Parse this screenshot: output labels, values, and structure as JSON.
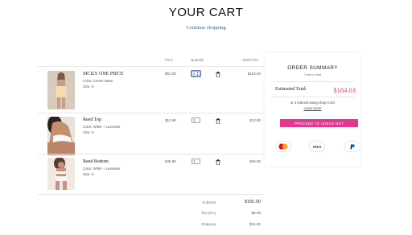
{
  "page": {
    "title": "YOUR CART",
    "continue_label": "Continue shopping"
  },
  "table_headers": {
    "price": "Price",
    "quantity": "Quantity",
    "total_price": "Total Price"
  },
  "items": [
    {
      "name": "SICILY ONE PIECE",
      "color": "Color: Creme Wave",
      "size": "Size: S",
      "price": "$51.00",
      "quantity": "2",
      "total": "$102.00"
    },
    {
      "name": "Reed Top",
      "color": "Color: White + Lavender",
      "size": "Size: S",
      "price": "$12.90",
      "quantity": "1",
      "total": "$12.90"
    },
    {
      "name": "Reed Bottom",
      "color": "Color: White + Lavender",
      "size": "Size: S",
      "price": "$45.90",
      "quantity": "1",
      "total": "$45.90"
    }
  ],
  "summary": {
    "subtotal_label": "Subtotal",
    "subtotal_value": "$160.90",
    "tax_label": "Tax (5%)",
    "tax_value": "$8.05",
    "shipping_label": "Shipping",
    "shipping_value": "$15.00"
  },
  "order_summary": {
    "title": "ORDER SUMMARY",
    "items_total": "3 items total",
    "estimated_label": "Estimated Total:",
    "estimated_value": "$184.03",
    "interest_text": "or 4 interest using shop CGO",
    "learn_more": "Learn more",
    "checkout_label": "PROCEED TO CHECK OUT",
    "payment_methods": [
      "mastercard-icon",
      "visa-icon",
      "paypal-icon"
    ],
    "visa_text": "VISA",
    "accent_color": "#e2368f"
  }
}
